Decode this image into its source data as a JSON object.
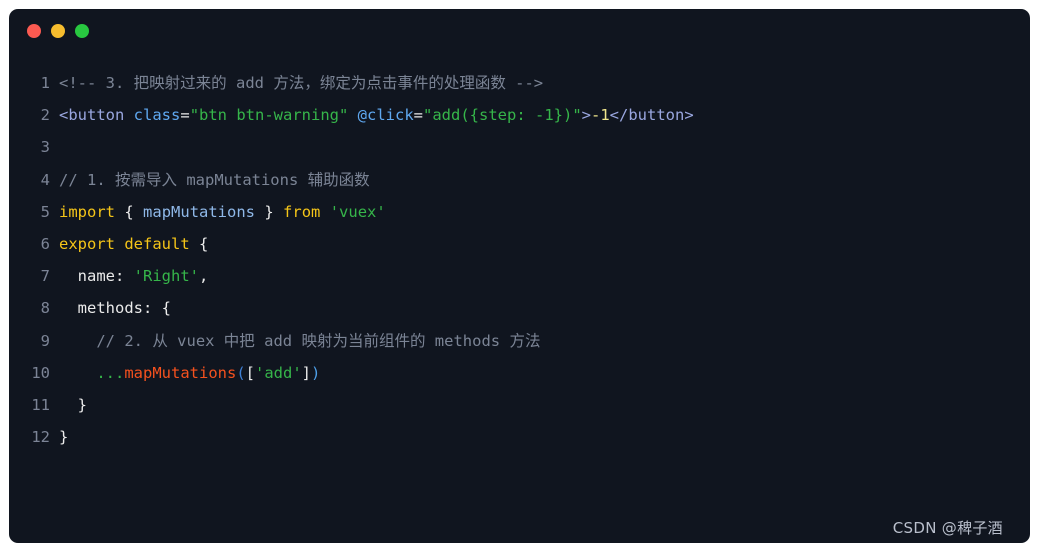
{
  "window": {
    "background_color": "#10151f",
    "page_background_color": "#ffffff",
    "controls": [
      {
        "name": "close",
        "color": "#fb5a51"
      },
      {
        "name": "minimize",
        "color": "#f7bd2e"
      },
      {
        "name": "maximize",
        "color": "#28c840"
      }
    ]
  },
  "editor": {
    "language": "vue",
    "gutter_color": "#7c8496",
    "lines": [
      {
        "number": "1",
        "text": "<!-- 3. 把映射过来的 add 方法，绑定为点击事件的处理函数 -->",
        "tokens": [
          {
            "t": "<!-- 3. 把映射过来的 add 方法，绑定为点击事件的处理函数 -->",
            "c": "tok-comment"
          }
        ]
      },
      {
        "number": "2",
        "text": "<button class=\"btn btn-warning\" @click=\"add({step: -1})\">-1</button>",
        "tokens": [
          {
            "t": "<button",
            "c": "tok-tag"
          },
          {
            "t": " ",
            "c": "tok-plain"
          },
          {
            "t": "class",
            "c": "tok-attr"
          },
          {
            "t": "=",
            "c": "tok-plain"
          },
          {
            "t": "\"btn btn-warning\"",
            "c": "tok-string"
          },
          {
            "t": " ",
            "c": "tok-plain"
          },
          {
            "t": "@click",
            "c": "tok-attr"
          },
          {
            "t": "=",
            "c": "tok-plain"
          },
          {
            "t": "\"add({step: -1})\"",
            "c": "tok-string"
          },
          {
            "t": ">",
            "c": "tok-tag"
          },
          {
            "t": "-1",
            "c": "tok-number"
          },
          {
            "t": "</button>",
            "c": "tok-tag"
          }
        ]
      },
      {
        "number": "3",
        "text": "",
        "tokens": []
      },
      {
        "number": "4",
        "text": "// 1. 按需导入 mapMutations 辅助函数",
        "tokens": [
          {
            "t": "// 1. 按需导入 mapMutations 辅助函数",
            "c": "tok-comment"
          }
        ]
      },
      {
        "number": "5",
        "text": "import { mapMutations } from 'vuex'",
        "tokens": [
          {
            "t": "import",
            "c": "tok-keyword"
          },
          {
            "t": " ",
            "c": "tok-plain"
          },
          {
            "t": "{",
            "c": "tok-brace"
          },
          {
            "t": " ",
            "c": "tok-plain"
          },
          {
            "t": "mapMutations",
            "c": "tok-ident"
          },
          {
            "t": " ",
            "c": "tok-plain"
          },
          {
            "t": "}",
            "c": "tok-brace"
          },
          {
            "t": " ",
            "c": "tok-plain"
          },
          {
            "t": "from",
            "c": "tok-keyword"
          },
          {
            "t": " ",
            "c": "tok-plain"
          },
          {
            "t": "'vuex'",
            "c": "tok-string"
          }
        ]
      },
      {
        "number": "6",
        "text": "export default {",
        "tokens": [
          {
            "t": "export",
            "c": "tok-keyword"
          },
          {
            "t": " ",
            "c": "tok-plain"
          },
          {
            "t": "default",
            "c": "tok-keyword"
          },
          {
            "t": " ",
            "c": "tok-plain"
          },
          {
            "t": "{",
            "c": "tok-brace"
          }
        ]
      },
      {
        "number": "7",
        "text": "  name: 'Right',",
        "tokens": [
          {
            "t": "  ",
            "c": "tok-plain"
          },
          {
            "t": "name",
            "c": "tok-prop"
          },
          {
            "t": ": ",
            "c": "tok-plain"
          },
          {
            "t": "'Right'",
            "c": "tok-string"
          },
          {
            "t": ",",
            "c": "tok-plain"
          }
        ]
      },
      {
        "number": "8",
        "text": "  methods: {",
        "tokens": [
          {
            "t": "  ",
            "c": "tok-plain"
          },
          {
            "t": "methods",
            "c": "tok-prop"
          },
          {
            "t": ": ",
            "c": "tok-plain"
          },
          {
            "t": "{",
            "c": "tok-brace"
          }
        ]
      },
      {
        "number": "9",
        "text": "    // 2. 从 vuex 中把 add 映射为当前组件的 methods 方法",
        "tokens": [
          {
            "t": "    ",
            "c": "tok-plain"
          },
          {
            "t": "// 2. 从 vuex 中把 add 映射为当前组件的 methods 方法",
            "c": "tok-comment"
          }
        ]
      },
      {
        "number": "10",
        "text": "    ...mapMutations(['add'])",
        "tokens": [
          {
            "t": "    ",
            "c": "tok-plain"
          },
          {
            "t": "...",
            "c": "tok-spread"
          },
          {
            "t": "mapMutations",
            "c": "tok-func"
          },
          {
            "t": "(",
            "c": "tok-magenta"
          },
          {
            "t": "[",
            "c": "tok-brace"
          },
          {
            "t": "'add'",
            "c": "tok-string"
          },
          {
            "t": "]",
            "c": "tok-brace"
          },
          {
            "t": ")",
            "c": "tok-punct"
          }
        ]
      },
      {
        "number": "11",
        "text": "  }",
        "tokens": [
          {
            "t": "  ",
            "c": "tok-plain"
          },
          {
            "t": "}",
            "c": "tok-brace"
          }
        ]
      },
      {
        "number": "12",
        "text": "}",
        "tokens": [
          {
            "t": "}",
            "c": "tok-brace"
          }
        ]
      }
    ]
  },
  "watermark": {
    "text": "CSDN @稗子酒"
  }
}
